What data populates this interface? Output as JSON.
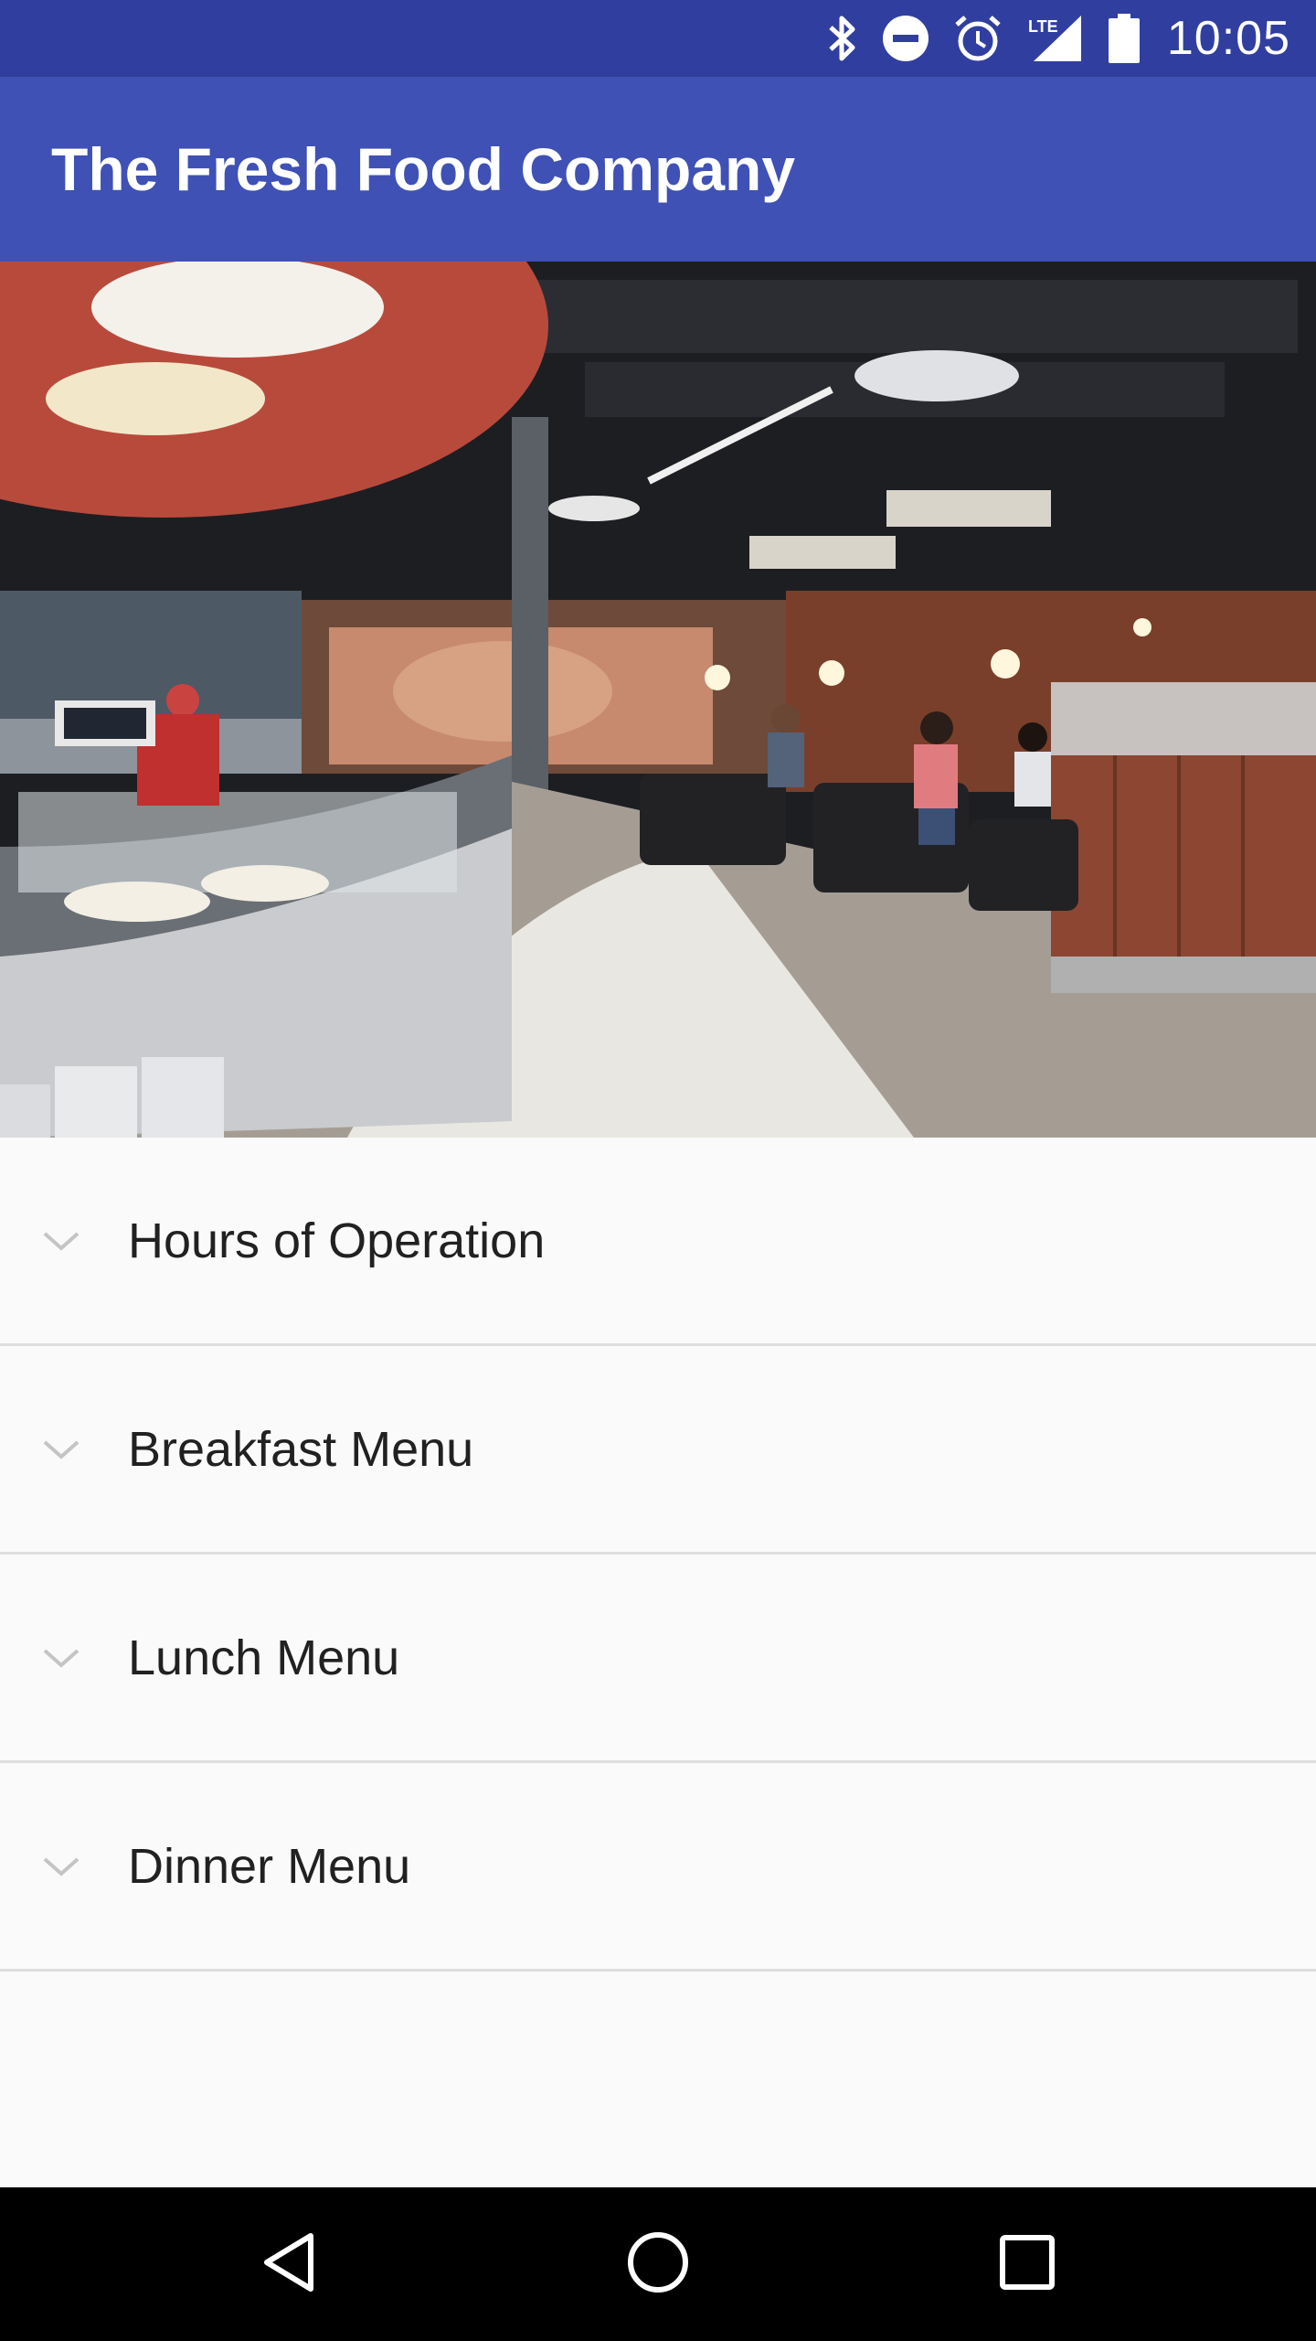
{
  "status_bar": {
    "time": "10:05",
    "network": "LTE",
    "icons": [
      "bluetooth-icon",
      "do-not-disturb-icon",
      "alarm-icon",
      "lte-signal-icon",
      "battery-icon"
    ]
  },
  "app_bar": {
    "title": "The Fresh Food Company",
    "color": "#3f51b5",
    "status_color": "#303f9f"
  },
  "hero_image": {
    "description_icon": "dining-hall-photo"
  },
  "sections": [
    {
      "label": "Hours of Operation",
      "icon": "chevron-down-icon",
      "expanded": false
    },
    {
      "label": "Breakfast Menu",
      "icon": "chevron-down-icon",
      "expanded": false
    },
    {
      "label": "Lunch Menu",
      "icon": "chevron-down-icon",
      "expanded": false
    },
    {
      "label": "Dinner Menu",
      "icon": "chevron-down-icon",
      "expanded": false
    }
  ],
  "nav_bar": {
    "buttons": [
      "back-icon",
      "home-icon",
      "recents-icon"
    ]
  }
}
